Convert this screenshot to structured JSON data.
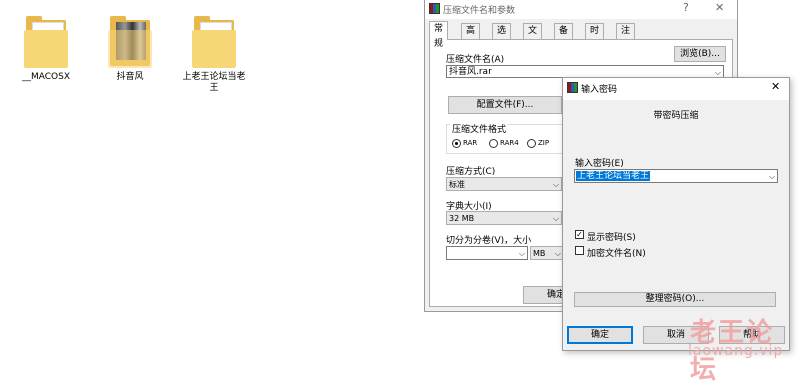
{
  "desktop": {
    "folders": [
      {
        "label": "__MACOSX",
        "icon": "folder-icon"
      },
      {
        "label": "抖音风",
        "icon": "folder-photo-icon"
      },
      {
        "label": "上老王论坛当老王",
        "icon": "folder-icon"
      }
    ]
  },
  "archive_dialog": {
    "title": "压缩文件名和参数",
    "help": "?",
    "close": "✕",
    "tabs": [
      "常规",
      "高级",
      "选项",
      "文件",
      "备份",
      "时间",
      "注释"
    ],
    "archive_name_label": "压缩文件名(A)",
    "browse": "浏览(B)...",
    "archive_name_value": "抖音风.rar",
    "profiles": "配置文件(F)...",
    "format_label": "压缩文件格式",
    "formats": [
      "RAR",
      "RAR4",
      "ZIP"
    ],
    "method_label": "压缩方式(C)",
    "method_value": "标准",
    "dict_label": "字典大小(I)",
    "dict_value": "32 MB",
    "split_label": "切分为分卷(V)，大小",
    "split_value": "",
    "split_unit": "MB",
    "ok_partial": "确定"
  },
  "password_dialog": {
    "title": "输入密码",
    "close": "✕",
    "heading": "带密码压缩",
    "password_label": "输入密码(E)",
    "password_value": "上老王论坛当老王",
    "show_password": "显示密码(S)",
    "show_password_checked": true,
    "encrypt_names": "加密文件名(N)",
    "encrypt_names_checked": false,
    "organize": "整理密码(O)...",
    "ok": "确定",
    "cancel": "取消",
    "help": "帮助"
  },
  "watermark": {
    "line1": "老王论坛",
    "line2": "laowang.vip"
  },
  "colors": {
    "selection": "#0078d7",
    "watermark": "#f2a0a0"
  }
}
